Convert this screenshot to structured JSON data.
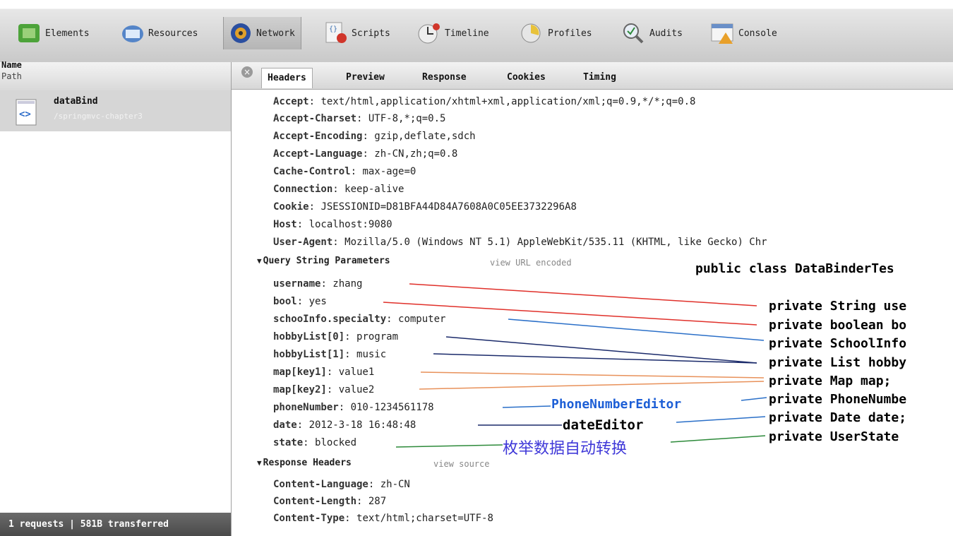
{
  "toolbar": {
    "items": [
      {
        "label": "Elements",
        "icon": "elements-icon"
      },
      {
        "label": "Resources",
        "icon": "resources-icon"
      },
      {
        "label": "Network",
        "icon": "network-icon",
        "active": true
      },
      {
        "label": "Scripts",
        "icon": "scripts-icon"
      },
      {
        "label": "Timeline",
        "icon": "timeline-icon"
      },
      {
        "label": "Profiles",
        "icon": "profiles-icon"
      },
      {
        "label": "Audits",
        "icon": "audits-icon"
      },
      {
        "label": "Console",
        "icon": "console-icon"
      }
    ]
  },
  "left": {
    "header_name": "Name",
    "header_path": "Path",
    "request": {
      "name": "dataBind",
      "path": "/springmvc-chapter3",
      "icon": "html-file-icon"
    },
    "status": "1 requests  |  581B transferred"
  },
  "detail": {
    "tabs": [
      "Headers",
      "Preview",
      "Response",
      "Cookies",
      "Timing"
    ],
    "active_tab": "Headers",
    "request_headers": [
      {
        "k": "Accept",
        "v": "text/html,application/xhtml+xml,application/xml;q=0.9,*/*;q=0.8"
      },
      {
        "k": "Accept-Charset",
        "v": "UTF-8,*;q=0.5"
      },
      {
        "k": "Accept-Encoding",
        "v": "gzip,deflate,sdch"
      },
      {
        "k": "Accept-Language",
        "v": "zh-CN,zh;q=0.8"
      },
      {
        "k": "Cache-Control",
        "v": "max-age=0"
      },
      {
        "k": "Connection",
        "v": "keep-alive"
      },
      {
        "k": "Cookie",
        "v": "JSESSIONID=D81BFA44D84A7608A0C05EE3732296A8"
      },
      {
        "k": "Host",
        "v": "localhost:9080"
      },
      {
        "k": "User-Agent",
        "v": "Mozilla/5.0 (Windows NT 5.1) AppleWebKit/535.11 (KHTML, like Gecko) Chr"
      }
    ],
    "query_section": {
      "title": "Query String Parameters",
      "link": "view URL encoded"
    },
    "query_params": [
      {
        "k": "username",
        "v": "zhang"
      },
      {
        "k": "bool",
        "v": "yes"
      },
      {
        "k": "schooInfo.specialty",
        "v": "computer"
      },
      {
        "k": "hobbyList[0]",
        "v": "program"
      },
      {
        "k": "hobbyList[1]",
        "v": "music"
      },
      {
        "k": "map[key1]",
        "v": "value1"
      },
      {
        "k": "map[key2]",
        "v": "value2"
      },
      {
        "k": "phoneNumber",
        "v": "010-1234561178"
      },
      {
        "k": "date",
        "v": "2012-3-18 16:48:48"
      },
      {
        "k": "state",
        "v": "blocked"
      }
    ],
    "response_section": {
      "title": "Response Headers",
      "link": "view source"
    },
    "response_headers": [
      {
        "k": "Content-Language",
        "v": "zh-CN"
      },
      {
        "k": "Content-Length",
        "v": "287"
      },
      {
        "k": "Content-Type",
        "v": "text/html;charset=UTF-8"
      }
    ]
  },
  "annotations": {
    "class_decl": "public class DataBinderTes",
    "fields": [
      "private String use",
      "private boolean bo",
      "private SchoolInfo",
      "private List hobby",
      "private Map map;",
      "private PhoneNumbe",
      "private Date date;",
      "private UserState"
    ],
    "phone_editor": "PhoneNumberEditor",
    "date_editor": "dateEditor",
    "enum_note": "枚举数据自动转换",
    "colors": {
      "red": "#e0302a",
      "blue": "#2a6fc8",
      "dark_blue": "#1a2a6a",
      "orange": "#e8915a",
      "green": "#2d8a3a",
      "phone_label": "#1d5fd6",
      "enum_label": "#3f38d8"
    }
  }
}
